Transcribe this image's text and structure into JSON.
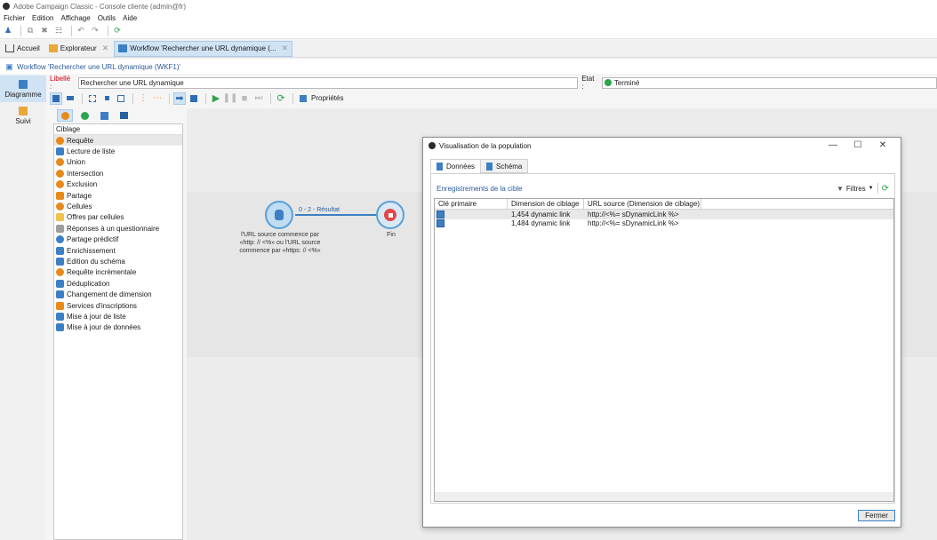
{
  "window": {
    "title": "Adobe Campaign Classic - Console cliente (admin@fr)"
  },
  "menu": [
    "Fichier",
    "Edition",
    "Affichage",
    "Outils",
    "Aide"
  ],
  "tabs": {
    "home": "Accueil",
    "explorer": "Explorateur",
    "workflow": "Workflow 'Rechercher une URL dynamique (..."
  },
  "breadcrumb": "Workflow 'Rechercher une URL dynamique (WKF1)'",
  "leftnav": {
    "diagram": "Diagramme",
    "monitoring": "Suivi"
  },
  "form": {
    "libelle_label": "Libellé :",
    "libelle_value": "Rechercher une URL dynamique",
    "etat_label": "Etat :",
    "etat_value": "Terminé"
  },
  "toolbar": {
    "properties": "Propriétés"
  },
  "palette": {
    "header": "Ciblage",
    "items": [
      "Requête",
      "Lecture de liste",
      "Union",
      "Intersection",
      "Exclusion",
      "Partage",
      "Cellules",
      "Offres par cellules",
      "Réponses à un questionnaire",
      "Partage prédictif",
      "Enrichissement",
      "Edition du schéma",
      "Requête incrémentale",
      "Déduplication",
      "Changement de dimension",
      "Services d'inscriptions",
      "Mise à jour de liste",
      "Mise à jour de données"
    ]
  },
  "workflow": {
    "query_label": "l'URL source commence par «http: // <%» ou l'URL source commence par «https: // <%»",
    "transition_label": "0 - 2 - Résultat",
    "end_label": "Fin"
  },
  "dialog": {
    "title": "Visualisation de la population",
    "tabs": [
      "Données",
      "Schéma"
    ],
    "section": "Enregistrements de la cible",
    "filters": "Filtres",
    "columns": [
      "Clé primaire",
      "Dimension de ciblage",
      "URL source (Dimension de ciblage)"
    ],
    "rows": [
      {
        "dimension": "1,454 dynamic link",
        "url": "http://<%= sDynamicLink %>"
      },
      {
        "dimension": "1,484 dynamic link",
        "url": "http://<%= sDynamicLink %>"
      }
    ],
    "close_button": "Fermer"
  }
}
